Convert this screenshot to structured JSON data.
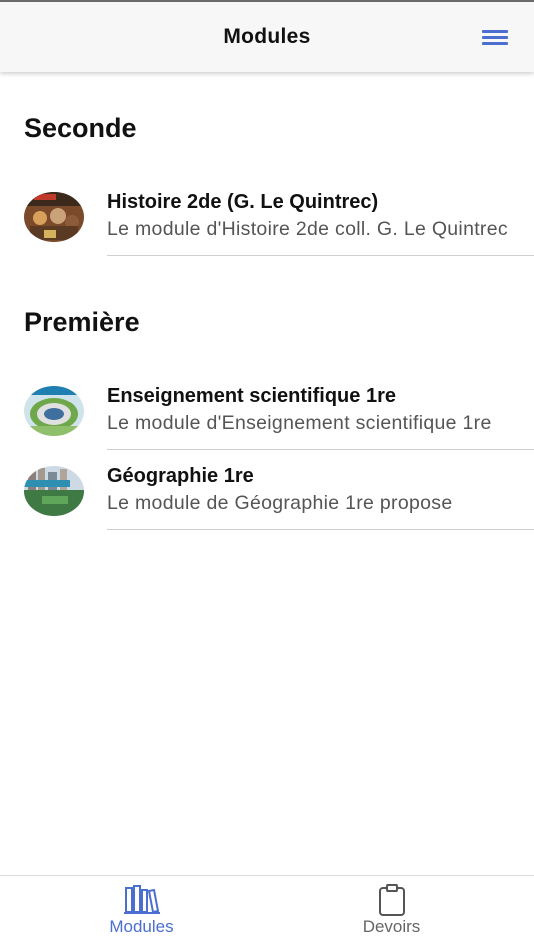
{
  "header": {
    "title": "Modules",
    "menu_icon": "hamburger-menu-icon"
  },
  "sections": [
    {
      "title": "Seconde",
      "items": [
        {
          "title": "Histoire 2de (G. Le Quintrec)",
          "subtitle": "Le module d'Histoire 2de coll. G. Le Quintrec"
        }
      ]
    },
    {
      "title": "Première",
      "items": [
        {
          "title": "Enseignement scientifique 1re",
          "subtitle": "Le module d'Enseignement scientifique 1re"
        },
        {
          "title": "Géographie 1re",
          "subtitle": "Le module de Géographie 1re propose"
        }
      ]
    }
  ],
  "tabbar": {
    "tabs": [
      {
        "label": "Modules",
        "icon": "books-icon",
        "active": true
      },
      {
        "label": "Devoirs",
        "icon": "clipboard-icon",
        "active": false
      }
    ]
  },
  "colors": {
    "accent": "#4a6fd0",
    "header_bg": "#f7f7f7",
    "separator": "#cfcfcf",
    "subtitle": "#555555"
  }
}
